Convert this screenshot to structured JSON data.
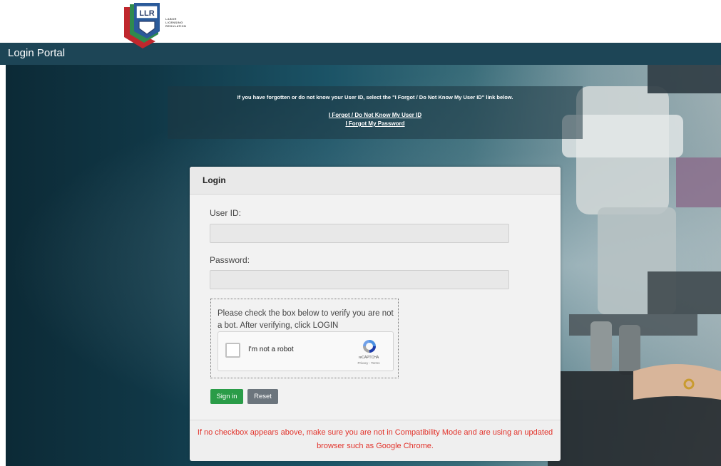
{
  "header": {
    "logo_text": "LLR",
    "logo_subtitle_1": "LABOR",
    "logo_subtitle_2": "LICENSING",
    "logo_subtitle_3": "REGULATION",
    "portal_title": "Login Portal"
  },
  "info": {
    "message": "If you have forgotten or do not know your User ID, select the \"I Forgot / Do Not Know My User ID\" link below.",
    "forgot_userid_link": "I Forgot / Do Not Know My User ID",
    "forgot_password_link": "I Forgot My Password"
  },
  "login": {
    "title": "Login",
    "userid_label": "User ID:",
    "userid_value": "",
    "password_label": "Password:",
    "password_value": "",
    "captcha_instructions": "Please check the box below to verify you are not a bot. After verifying, click LOGIN",
    "recaptcha_label": "I'm not a robot",
    "recaptcha_brand": "reCAPTCHA",
    "recaptcha_terms": "Privacy - Terms",
    "signin_button": "Sign in",
    "reset_button": "Reset",
    "footer_note": "If no checkbox appears above, make sure you are not in Compatibility Mode and are using an updated browser such as Google Chrome."
  },
  "colors": {
    "portal_bar": "#1d4556",
    "signin_green": "#2a9c48",
    "reset_gray": "#6c757d",
    "warning_red": "#e2332b"
  }
}
